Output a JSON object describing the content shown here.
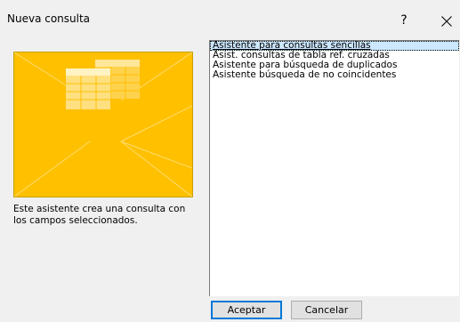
{
  "window": {
    "title": "Nueva consulta",
    "help_label": "?",
    "close_icon": "close-icon"
  },
  "preview": {
    "icon": "table-grid-icon",
    "accent_color": "#ffc000",
    "description": "Este asistente crea una consulta con los campos seleccionados."
  },
  "wizards": {
    "selected_index": 0,
    "items": [
      "Asistente para consultas sencillas",
      "Asist. consultas de tabla ref. cruzadas",
      "Asistente para búsqueda de duplicados",
      "Asistente búsqueda de no coincidentes"
    ]
  },
  "buttons": {
    "accept_label": "Aceptar",
    "cancel_label": "Cancelar"
  }
}
